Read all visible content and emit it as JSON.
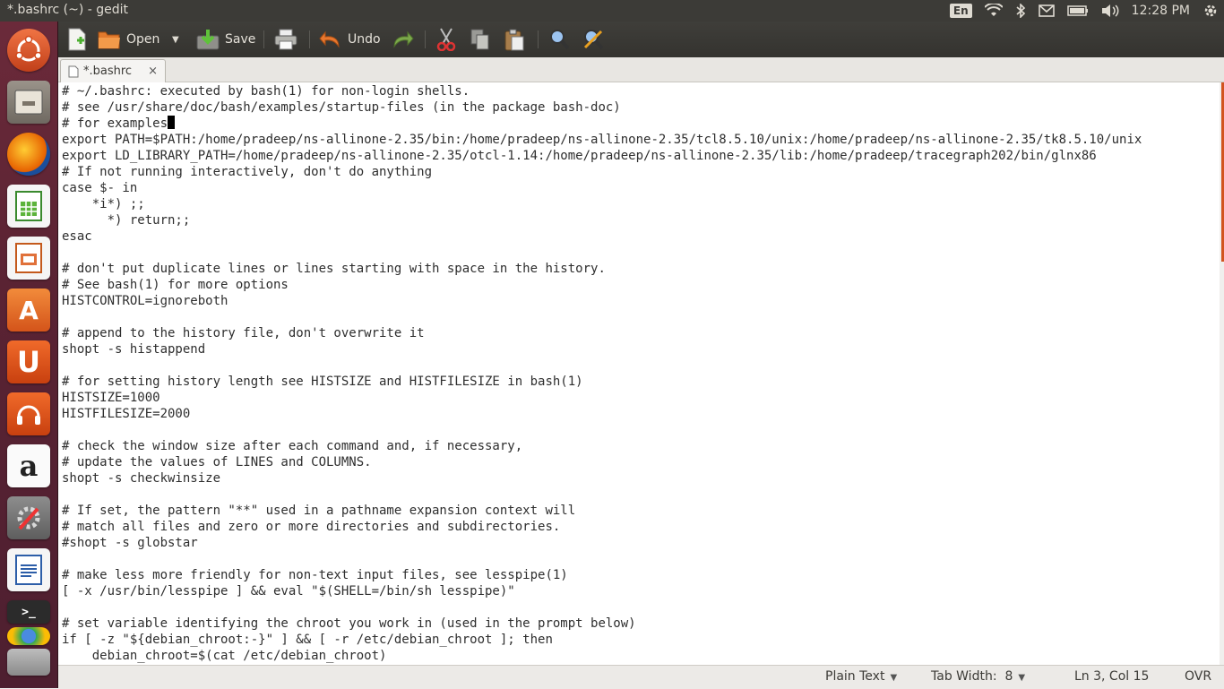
{
  "window": {
    "title": "*.bashrc (~) - gedit"
  },
  "top_panel": {
    "keyboard_layout": "En",
    "clock": "12:28 PM",
    "icons": [
      "wifi-icon",
      "bluetooth-icon",
      "mail-icon",
      "battery-icon",
      "volume-icon",
      "gear-icon"
    ]
  },
  "launcher": {
    "items": [
      "dash-home",
      "files",
      "firefox",
      "libreoffice-calc",
      "libreoffice-impress",
      "ubuntu-software-center",
      "ubuntu-one",
      "ubuntu-one-music",
      "amazon",
      "system-settings",
      "libreoffice-writer",
      "terminal",
      "chromium",
      "workspace-switcher"
    ]
  },
  "toolbar": {
    "open_label": "Open",
    "save_label": "Save",
    "undo_label": "Undo"
  },
  "tabs": [
    {
      "label": "*.bashrc",
      "close": "×"
    }
  ],
  "editor": {
    "lines": [
      "# ~/.bashrc: executed by bash(1) for non-login shells.",
      "# see /usr/share/doc/bash/examples/startup-files (in the package bash-doc)",
      "# for examples",
      "export PATH=$PATH:/home/pradeep/ns-allinone-2.35/bin:/home/pradeep/ns-allinone-2.35/tcl8.5.10/unix:/home/pradeep/ns-allinone-2.35/tk8.5.10/unix",
      "export LD_LIBRARY_PATH=/home/pradeep/ns-allinone-2.35/otcl-1.14:/home/pradeep/ns-allinone-2.35/lib:/home/pradeep/tracegraph202/bin/glnx86",
      "# If not running interactively, don't do anything",
      "case $- in",
      "    *i*) ;;",
      "      *) return;;",
      "esac",
      "",
      "# don't put duplicate lines or lines starting with space in the history.",
      "# See bash(1) for more options",
      "HISTCONTROL=ignoreboth",
      "",
      "# append to the history file, don't overwrite it",
      "shopt -s histappend",
      "",
      "# for setting history length see HISTSIZE and HISTFILESIZE in bash(1)",
      "HISTSIZE=1000",
      "HISTFILESIZE=2000",
      "",
      "# check the window size after each command and, if necessary,",
      "# update the values of LINES and COLUMNS.",
      "shopt -s checkwinsize",
      "",
      "# If set, the pattern \"**\" used in a pathname expansion context will",
      "# match all files and zero or more directories and subdirectories.",
      "#shopt -s globstar",
      "",
      "# make less more friendly for non-text input files, see lesspipe(1)",
      "[ -x /usr/bin/lesspipe ] && eval \"$(SHELL=/bin/sh lesspipe)\"",
      "",
      "# set variable identifying the chroot you work in (used in the prompt below)",
      "if [ -z \"${debian_chroot:-}\" ] && [ -r /etc/debian_chroot ]; then",
      "    debian_chroot=$(cat /etc/debian_chroot)"
    ],
    "cursor_line": 3
  },
  "statusbar": {
    "language": "Plain Text",
    "tab_width": "Tab Width:  8",
    "position": "Ln 3, Col 15",
    "mode": "OVR"
  },
  "colors": {
    "panel": "#3c3b37",
    "launcher": "#5a2333",
    "accent": "#dd4814"
  }
}
